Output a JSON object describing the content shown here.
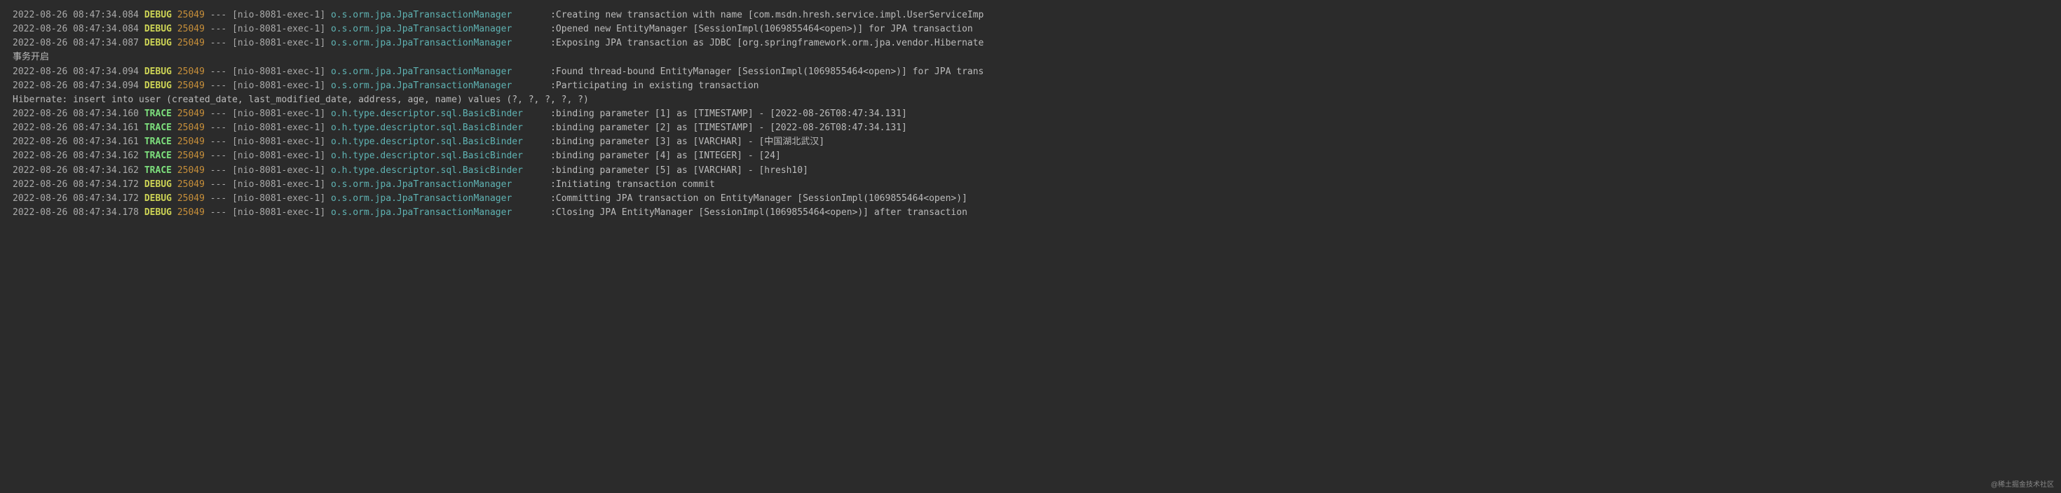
{
  "lines": [
    {
      "type": "log",
      "ts": "2022-08-26 08:47:34.084",
      "level": "DEBUG",
      "pid": "25049",
      "sep": "---",
      "thread": "[nio-8081-exec-1]",
      "logger": "o.s.orm.jpa.JpaTransactionManager",
      "msg": "Creating new transaction with name [com.msdn.hresh.service.impl.UserServiceImp"
    },
    {
      "type": "log",
      "ts": "2022-08-26 08:47:34.084",
      "level": "DEBUG",
      "pid": "25049",
      "sep": "---",
      "thread": "[nio-8081-exec-1]",
      "logger": "o.s.orm.jpa.JpaTransactionManager",
      "msg": "Opened new EntityManager [SessionImpl(1069855464<open>)] for JPA transaction"
    },
    {
      "type": "log",
      "ts": "2022-08-26 08:47:34.087",
      "level": "DEBUG",
      "pid": "25049",
      "sep": "---",
      "thread": "[nio-8081-exec-1]",
      "logger": "o.s.orm.jpa.JpaTransactionManager",
      "msg": "Exposing JPA transaction as JDBC [org.springframework.orm.jpa.vendor.Hibernate"
    },
    {
      "type": "plain",
      "text": "事务开启"
    },
    {
      "type": "log",
      "ts": "2022-08-26 08:47:34.094",
      "level": "DEBUG",
      "pid": "25049",
      "sep": "---",
      "thread": "[nio-8081-exec-1]",
      "logger": "o.s.orm.jpa.JpaTransactionManager",
      "msg": "Found thread-bound EntityManager [SessionImpl(1069855464<open>)] for JPA trans"
    },
    {
      "type": "log",
      "ts": "2022-08-26 08:47:34.094",
      "level": "DEBUG",
      "pid": "25049",
      "sep": "---",
      "thread": "[nio-8081-exec-1]",
      "logger": "o.s.orm.jpa.JpaTransactionManager",
      "msg": "Participating in existing transaction"
    },
    {
      "type": "plain",
      "text": "Hibernate: insert into user (created_date, last_modified_date, address, age, name) values (?, ?, ?, ?, ?)"
    },
    {
      "type": "log",
      "ts": "2022-08-26 08:47:34.160",
      "level": "TRACE",
      "pid": "25049",
      "sep": "---",
      "thread": "[nio-8081-exec-1]",
      "logger": "o.h.type.descriptor.sql.BasicBinder",
      "msg": "binding parameter [1] as [TIMESTAMP] - [2022-08-26T08:47:34.131]"
    },
    {
      "type": "log",
      "ts": "2022-08-26 08:47:34.161",
      "level": "TRACE",
      "pid": "25049",
      "sep": "---",
      "thread": "[nio-8081-exec-1]",
      "logger": "o.h.type.descriptor.sql.BasicBinder",
      "msg": "binding parameter [2] as [TIMESTAMP] - [2022-08-26T08:47:34.131]"
    },
    {
      "type": "log",
      "ts": "2022-08-26 08:47:34.161",
      "level": "TRACE",
      "pid": "25049",
      "sep": "---",
      "thread": "[nio-8081-exec-1]",
      "logger": "o.h.type.descriptor.sql.BasicBinder",
      "msg": "binding parameter [3] as [VARCHAR] - [中国湖北武汉]"
    },
    {
      "type": "log",
      "ts": "2022-08-26 08:47:34.162",
      "level": "TRACE",
      "pid": "25049",
      "sep": "---",
      "thread": "[nio-8081-exec-1]",
      "logger": "o.h.type.descriptor.sql.BasicBinder",
      "msg": "binding parameter [4] as [INTEGER] - [24]"
    },
    {
      "type": "log",
      "ts": "2022-08-26 08:47:34.162",
      "level": "TRACE",
      "pid": "25049",
      "sep": "---",
      "thread": "[nio-8081-exec-1]",
      "logger": "o.h.type.descriptor.sql.BasicBinder",
      "msg": "binding parameter [5] as [VARCHAR] - [hresh10]"
    },
    {
      "type": "log",
      "ts": "2022-08-26 08:47:34.172",
      "level": "DEBUG",
      "pid": "25049",
      "sep": "---",
      "thread": "[nio-8081-exec-1]",
      "logger": "o.s.orm.jpa.JpaTransactionManager",
      "msg": "Initiating transaction commit"
    },
    {
      "type": "log",
      "ts": "2022-08-26 08:47:34.172",
      "level": "DEBUG",
      "pid": "25049",
      "sep": "---",
      "thread": "[nio-8081-exec-1]",
      "logger": "o.s.orm.jpa.JpaTransactionManager",
      "msg": "Committing JPA transaction on EntityManager [SessionImpl(1069855464<open>)]"
    },
    {
      "type": "log",
      "ts": "2022-08-26 08:47:34.178",
      "level": "DEBUG",
      "pid": "25049",
      "sep": "---",
      "thread": "[nio-8081-exec-1]",
      "logger": "o.s.orm.jpa.JpaTransactionManager",
      "msg": "Closing JPA EntityManager [SessionImpl(1069855464<open>)] after transaction"
    }
  ],
  "watermark": "@稀土掘金技术社区",
  "loggerColWidth": 40
}
